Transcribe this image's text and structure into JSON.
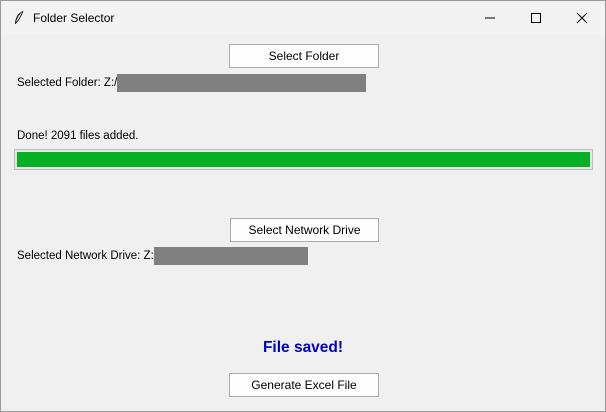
{
  "window": {
    "title": "Folder Selector",
    "icon": "feather-icon",
    "controls": [
      "minimize-icon",
      "maximize-icon",
      "close-icon"
    ]
  },
  "folder": {
    "button_label": "Select Folder",
    "selected_label": "Selected Folder: Z:/"
  },
  "status": {
    "message": "Done! 2091 files added.",
    "progress": 1.0,
    "progress_color": "#06b025"
  },
  "network": {
    "button_label": "Select Network Drive",
    "selected_label": "Selected Network Drive: Z:"
  },
  "result": {
    "message": "File saved!",
    "message_color": "#0000cc"
  },
  "excel": {
    "button_label": "Generate Excel File"
  }
}
